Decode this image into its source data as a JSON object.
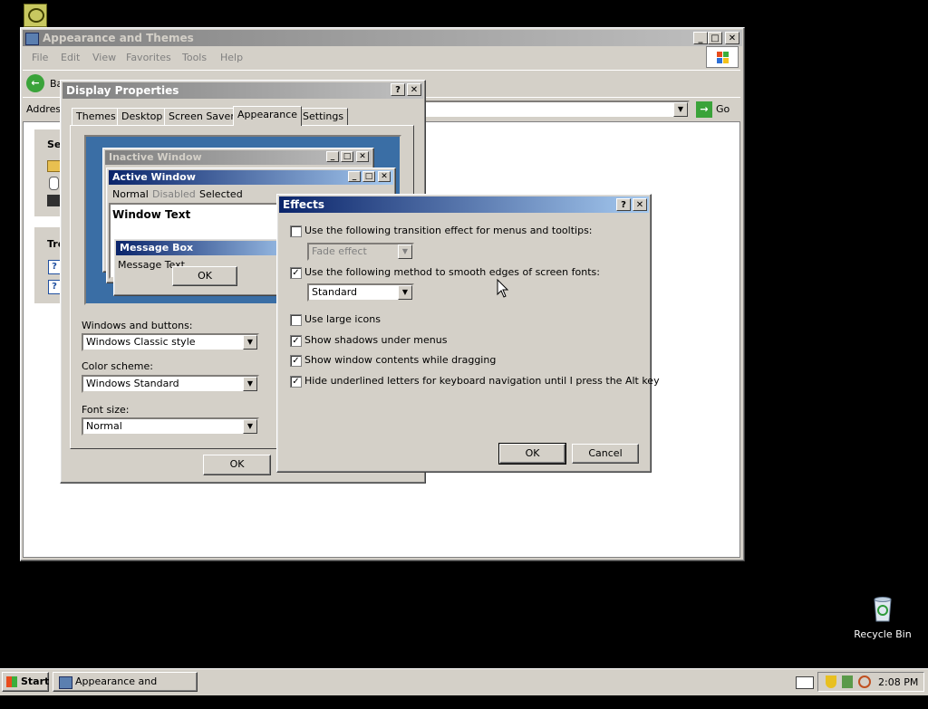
{
  "desktop": {
    "recycle_bin_label": "Recycle Bin"
  },
  "explorer": {
    "title": "Appearance and Themes",
    "menu": [
      "File",
      "Edit",
      "View",
      "Favorites",
      "Tools",
      "Help"
    ],
    "back_label": "Ba",
    "address_label": "Address",
    "go_label": "Go",
    "side_heading_1": "See",
    "side_heading_2": "Tro"
  },
  "display_properties": {
    "title": "Display Properties",
    "tabs": [
      "Themes",
      "Desktop",
      "Screen Saver",
      "Appearance",
      "Settings"
    ],
    "active_tab": "Appearance",
    "preview": {
      "inactive_title": "Inactive Window",
      "active_title": "Active Window",
      "menu_normal": "Normal",
      "menu_disabled": "Disabled",
      "menu_selected": "Selected",
      "window_text": "Window Text",
      "message_box_title": "Message Box",
      "message_text": "Message Text",
      "ok": "OK"
    },
    "windows_buttons_label": "Windows and buttons:",
    "windows_buttons_value": "Windows Classic style",
    "color_scheme_label": "Color scheme:",
    "color_scheme_value": "Windows Standard",
    "font_size_label": "Font size:",
    "font_size_value": "Normal",
    "ok": "OK"
  },
  "effects": {
    "title": "Effects",
    "options": [
      {
        "label": "Use the following transition effect for menus and tooltips:",
        "checked": false
      },
      {
        "label": "Use the following method to smooth edges of screen fonts:",
        "checked": true
      },
      {
        "label": "Use large icons",
        "checked": false
      },
      {
        "label": "Show shadows under menus",
        "checked": true
      },
      {
        "label": "Show window contents while dragging",
        "checked": true
      },
      {
        "label": "Hide underlined letters for keyboard navigation until I press the Alt key",
        "checked": true
      }
    ],
    "transition_value": "Fade effect",
    "smoothing_value": "Standard",
    "ok": "OK",
    "cancel": "Cancel"
  },
  "taskbar": {
    "start": "Start",
    "task": "Appearance and Themes",
    "clock": "2:08 PM"
  },
  "colors": {
    "title_active": "#0a246a",
    "title_inactive": "#808080",
    "face": "#d4d0c8",
    "preview_desktop": "#3a6ea5"
  }
}
